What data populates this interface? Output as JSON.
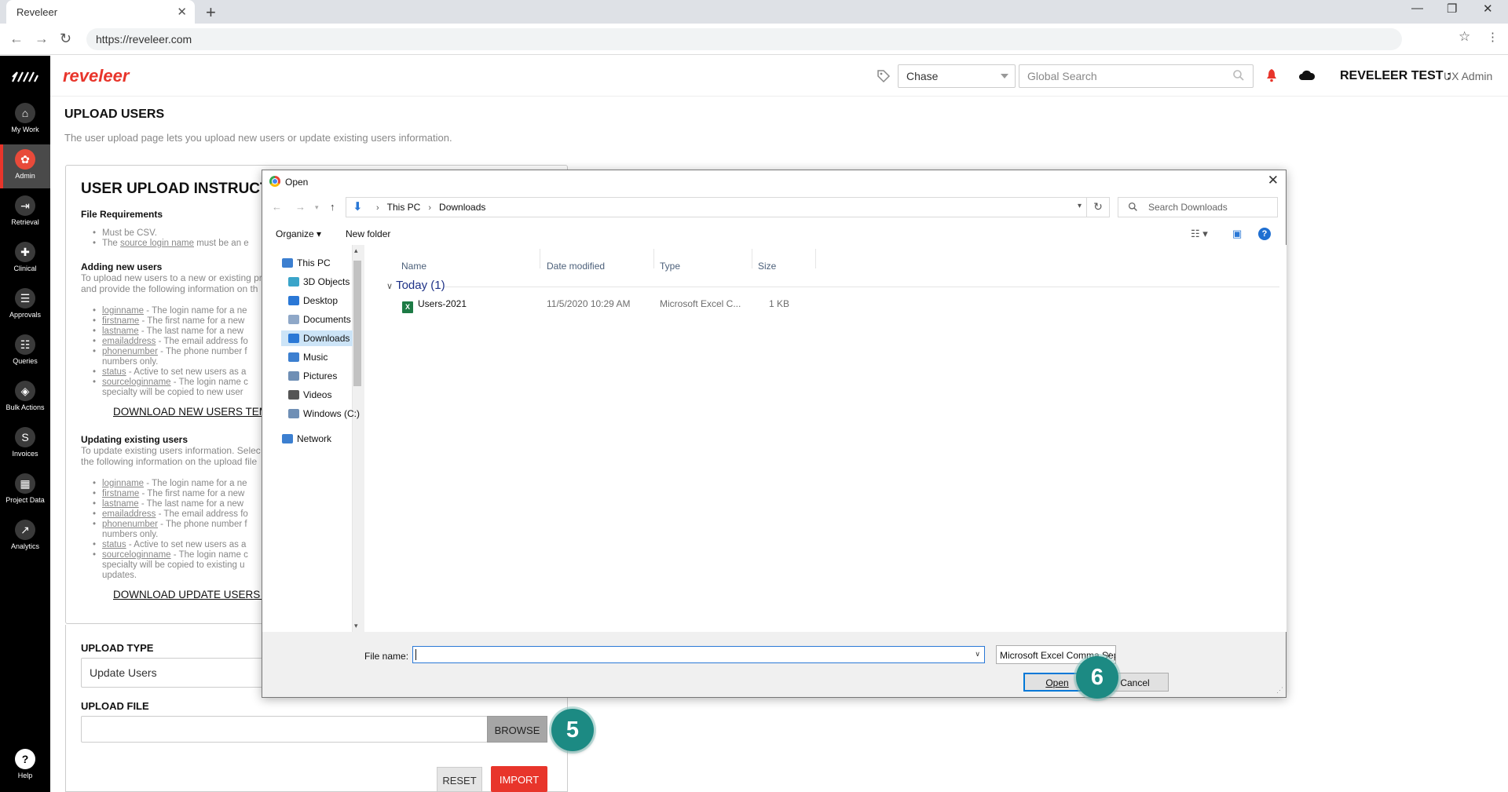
{
  "browser": {
    "tab_title": "Reveleer",
    "url": "https://reveleer.com"
  },
  "sidebar": {
    "items": [
      {
        "label": "My Work",
        "icon": "home-icon",
        "glyph": "⌂"
      },
      {
        "label": "Admin",
        "icon": "gear-icon",
        "glyph": "✿"
      },
      {
        "label": "Retrieval",
        "icon": "retrieval-icon",
        "glyph": "⇥"
      },
      {
        "label": "Clinical",
        "icon": "clinical-icon",
        "glyph": "✚"
      },
      {
        "label": "Approvals",
        "icon": "approvals-icon",
        "glyph": "☰"
      },
      {
        "label": "Queries",
        "icon": "queries-icon",
        "glyph": "☷"
      },
      {
        "label": "Bulk Actions",
        "icon": "layers-icon",
        "glyph": "◈"
      },
      {
        "label": "Invoices",
        "icon": "invoices-icon",
        "glyph": "S"
      },
      {
        "label": "Project Data",
        "icon": "project-data-icon",
        "glyph": "▦"
      },
      {
        "label": "Analytics",
        "icon": "analytics-icon",
        "glyph": "↗"
      }
    ],
    "help_label": "Help"
  },
  "header": {
    "brand": "reveleer",
    "client_select": "Chase",
    "search_placeholder": "Global Search",
    "org": "REVELEER TEST :",
    "role": "UX Admin"
  },
  "page": {
    "title": "UPLOAD USERS",
    "description": "The user upload page lets you upload new users or update existing users information.",
    "instructions_title": "USER UPLOAD INSTRUCTION",
    "file_req_heading": "File Requirements",
    "file_req_items": [
      "Must be CSV.",
      "The ",
      "source login name",
      " must be an e"
    ],
    "adding_heading": "Adding new users",
    "adding_para": "To upload new users to a new or existing pr",
    "adding_para2": "and provide the following information on th",
    "adding_fields": [
      {
        "name": "loginname",
        "desc": " - The login name for a ne"
      },
      {
        "name": "firstname",
        "desc": " - The first name for a new"
      },
      {
        "name": "lastname",
        "desc": " - The last name for a new"
      },
      {
        "name": "emailaddress",
        "desc": " - The email address fo"
      },
      {
        "name": "phonenumber",
        "desc": " - The phone number f"
      },
      {
        "name": "",
        "desc": "numbers only."
      },
      {
        "name": "status",
        "desc": " - Active to set new users as a"
      },
      {
        "name": "sourceloginname",
        "desc": " - The login name c"
      },
      {
        "name": "",
        "desc": "specialty will be copied to new user"
      }
    ],
    "download_new": "DOWNLOAD NEW USERS TEM",
    "updating_heading": "Updating existing users",
    "updating_para": "To update existing users information. Selec",
    "updating_para2": "the following information on the upload file",
    "updating_fields": [
      {
        "name": "loginname",
        "desc": " - The login name for a ne"
      },
      {
        "name": "firstname",
        "desc": " - The first name for a new"
      },
      {
        "name": "lastname",
        "desc": " - The last name for a new"
      },
      {
        "name": "emailaddress",
        "desc": " - The email address fo"
      },
      {
        "name": "phonenumber",
        "desc": " - The phone number f"
      },
      {
        "name": "",
        "desc": "numbers only."
      },
      {
        "name": "status",
        "desc": " - Active to set new users as a"
      },
      {
        "name": "sourceloginname",
        "desc": " - The login name c"
      },
      {
        "name": "",
        "desc": "specialty will be copied to existing u"
      },
      {
        "name": "",
        "desc": "updates."
      }
    ],
    "download_update": "DOWNLOAD UPDATE USERS T",
    "upload_type_label": "UPLOAD TYPE",
    "upload_type_value": "Update Users",
    "upload_file_label": "UPLOAD FILE",
    "browse": "BROWSE",
    "reset": "RESET",
    "import": "IMPORT",
    "step5": "5",
    "step6": "6"
  },
  "dialog": {
    "title": "Open",
    "path": [
      "This PC",
      "Downloads"
    ],
    "search_placeholder": "Search Downloads",
    "organize": "Organize",
    "new_folder": "New folder",
    "tree": [
      {
        "label": "This PC",
        "icon": "pc-icon"
      },
      {
        "label": "3D Objects",
        "icon": "3d-objects-icon"
      },
      {
        "label": "Desktop",
        "icon": "desktop-icon"
      },
      {
        "label": "Documents",
        "icon": "documents-icon"
      },
      {
        "label": "Downloads",
        "icon": "downloads-icon"
      },
      {
        "label": "Music",
        "icon": "music-icon"
      },
      {
        "label": "Pictures",
        "icon": "pictures-icon"
      },
      {
        "label": "Videos",
        "icon": "videos-icon"
      },
      {
        "label": "Windows (C:)",
        "icon": "drive-icon"
      },
      {
        "label": "Network",
        "icon": "network-icon"
      }
    ],
    "columns": [
      "Name",
      "Date modified",
      "Type",
      "Size"
    ],
    "group": "Today (1)",
    "files": [
      {
        "name": "Users-2021",
        "date": "11/5/2020 10:29 AM",
        "type": "Microsoft Excel C...",
        "size": "1 KB"
      }
    ],
    "file_name_label": "File name:",
    "file_name_value": "",
    "file_type": "Microsoft Excel Comma Separa",
    "open": "Open",
    "cancel": "Cancel"
  },
  "colors": {
    "brand_red": "#e8352b",
    "badge_teal": "#1c8a83",
    "dialog_blue": "#0078d7"
  }
}
